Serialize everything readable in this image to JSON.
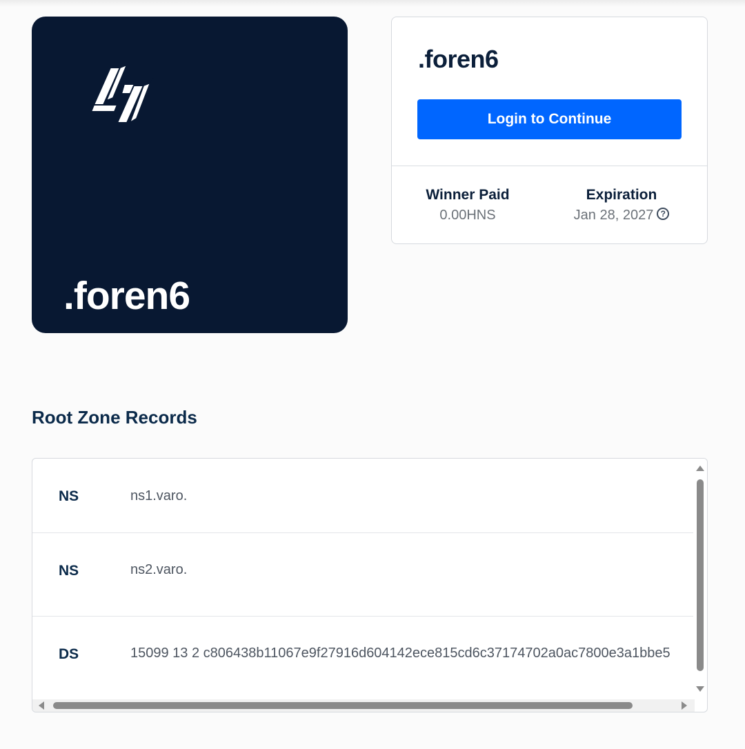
{
  "name_card": {
    "logo_icon": "handshake-h-logo-icon",
    "name": ".foren6",
    "background_color": "#081832"
  },
  "panel": {
    "title": ".foren6",
    "login_button": "Login to Continue",
    "stats": {
      "winner_label": "Winner Paid",
      "winner_value": "0.00HNS",
      "expiration_label": "Expiration",
      "expiration_value": "Jan 28, 2027",
      "help_icon": "question-circle-icon"
    }
  },
  "root_zone": {
    "title": "Root Zone Records",
    "records": [
      {
        "type": "NS",
        "value": "ns1.varo."
      },
      {
        "type": "NS",
        "value": "ns2.varo."
      },
      {
        "type": "DS",
        "value": "15099 13 2 c806438b11067e9f27916d604142ece815cd6c37174702a0ac7800e3a1bbe5"
      }
    ]
  },
  "colors": {
    "accent": "#0066ff",
    "heading": "#0b1f3a",
    "muted": "#6b7178"
  }
}
